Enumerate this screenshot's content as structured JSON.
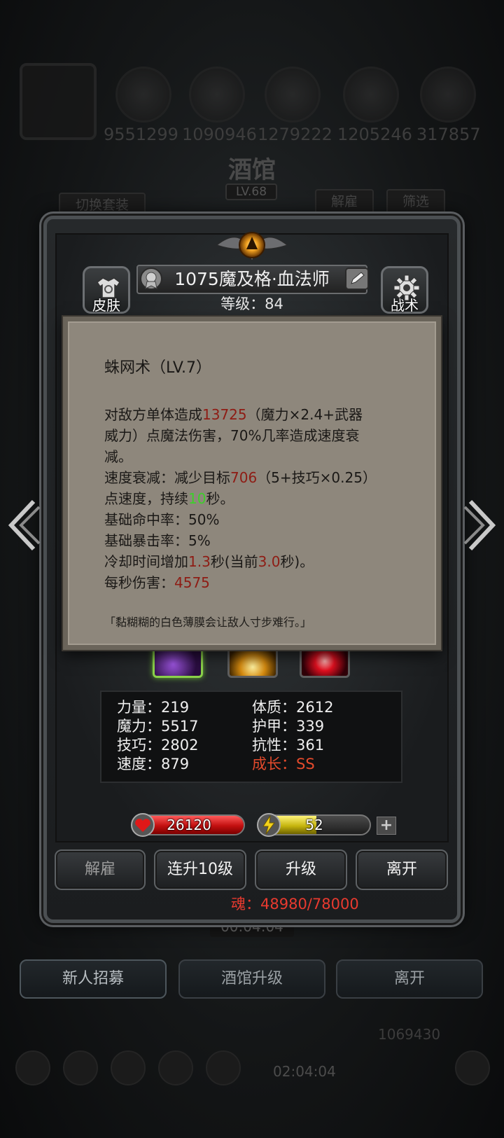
{
  "background": {
    "resource_values": [
      "9551299",
      "1090946",
      "1279222",
      "1205246",
      "317857"
    ],
    "title": "酒馆",
    "level": "LV.68",
    "switch_outfit_label": "切换套装",
    "dismiss_label": "解雇",
    "filter_label": "筛选",
    "timer": "00:04:04",
    "recruit_label": "新人招募",
    "tavern_upgrade_label": "酒馆升级",
    "leave_label": "离开",
    "gold": "1069430",
    "bottom_timer": "02:04:04"
  },
  "hero": {
    "name": "1075魔及格·血法师",
    "level_text": "等级：84",
    "skin_label": "皮肤",
    "tactics_label": "战术"
  },
  "tooltip": {
    "title": "蛛网术（LV.7）",
    "line1_a": "对敌方单体造成",
    "line1_dmg": "13725",
    "line1_b": "（魔力×2.4+武器",
    "line2": "威力）点魔法伤害，70%几率造成速度衰",
    "line3": "减。",
    "line4_a": "速度衰减：减少目标",
    "line4_val": "706",
    "line4_b": "（5+技巧×0.25）",
    "line5_a": "点速度，持续",
    "line5_val": "10",
    "line5_b": "秒。",
    "line6": "基础命中率：50%",
    "line7": "基础暴击率：5%",
    "line8_a": "冷却时间增加",
    "line8_v1": "1.3",
    "line8_b": "秒(当前",
    "line8_v2": "3.0",
    "line8_c": "秒)。",
    "line9_a": "每秒伤害：",
    "line9_val": "4575",
    "quote": "「黏糊糊的白色薄膜会让敌人寸步难行。」"
  },
  "stats": {
    "strength": "力量：219",
    "constitution": "体质：2612",
    "magic": "魔力：5517",
    "armor": "护甲：339",
    "skill": "技巧：2802",
    "resistance": "抗性：361",
    "speed": "速度：879",
    "growth": "成长：SS"
  },
  "bars": {
    "hp": "26120",
    "hp_fill": 1.0,
    "energy": "52",
    "energy_fill": 0.52
  },
  "actions": {
    "dismiss": "解雇",
    "level_up_10": "连升10级",
    "level_up": "升级",
    "leave": "离开",
    "soul": "魂：48980/78000"
  },
  "colors": {
    "tooltip_bg": "#8e877c",
    "damage_red": "#8e1c14",
    "duration_green": "#3dcf2a",
    "growth_red": "#e34a2c",
    "soul_red": "#e83a2f"
  },
  "icons": [
    "medal-icon",
    "edit-icon",
    "shirt-icon",
    "gear-icon",
    "heart-icon",
    "lightning-icon",
    "plus-icon",
    "arrow-left-icon",
    "arrow-right-icon"
  ]
}
